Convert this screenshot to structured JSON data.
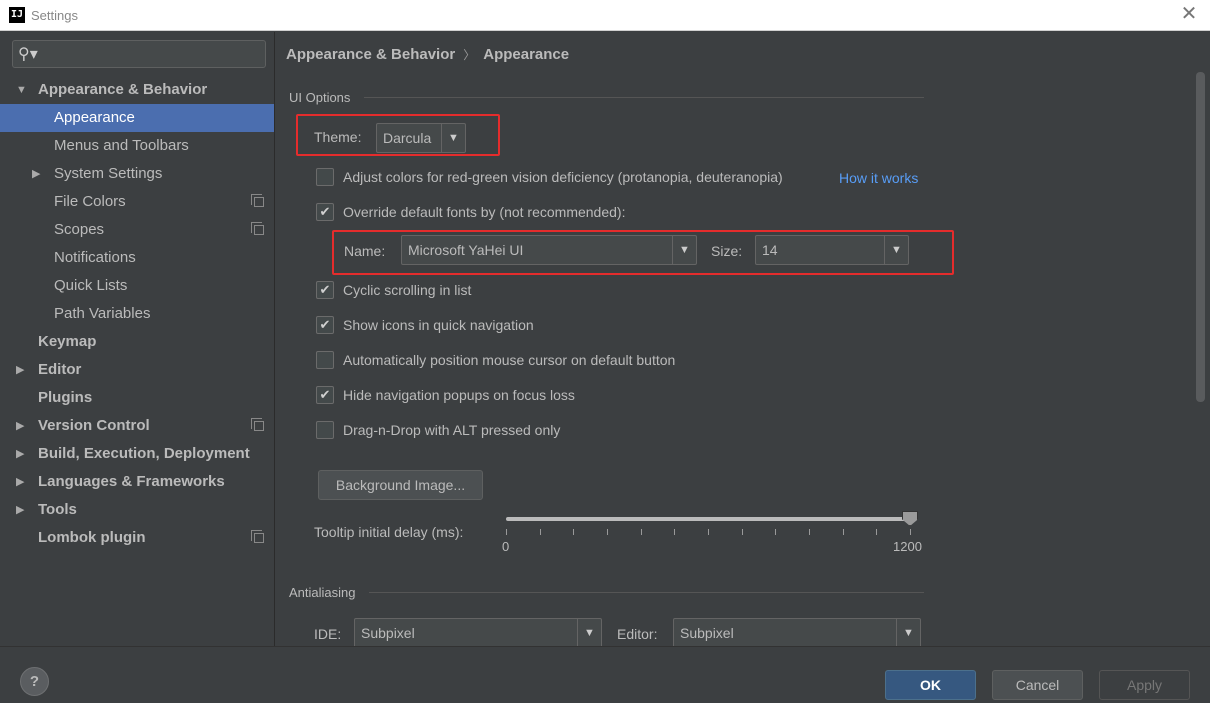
{
  "window": {
    "icon_text": "IJ",
    "title": "Settings",
    "close_glyph": "✕"
  },
  "sidebar": {
    "search": {
      "icon": "search-icon",
      "placeholder": "",
      "value": ""
    },
    "items": [
      {
        "label": "Appearance & Behavior",
        "level": 0,
        "bold": true,
        "expander": "▼",
        "copy": false
      },
      {
        "label": "Appearance",
        "level": 1,
        "bold": false,
        "expander": "",
        "copy": false,
        "selected": true
      },
      {
        "label": "Menus and Toolbars",
        "level": 1,
        "bold": false,
        "expander": "",
        "copy": false
      },
      {
        "label": "System Settings",
        "level": 1,
        "bold": false,
        "expander": "▶",
        "copy": false
      },
      {
        "label": "File Colors",
        "level": 1,
        "bold": false,
        "expander": "",
        "copy": true
      },
      {
        "label": "Scopes",
        "level": 1,
        "bold": false,
        "expander": "",
        "copy": true
      },
      {
        "label": "Notifications",
        "level": 1,
        "bold": false,
        "expander": "",
        "copy": false
      },
      {
        "label": "Quick Lists",
        "level": 1,
        "bold": false,
        "expander": "",
        "copy": false
      },
      {
        "label": "Path Variables",
        "level": 1,
        "bold": false,
        "expander": "",
        "copy": false
      },
      {
        "label": "Keymap",
        "level": 0,
        "bold": true,
        "expander": "",
        "copy": false
      },
      {
        "label": "Editor",
        "level": 0,
        "bold": true,
        "expander": "▶",
        "copy": false
      },
      {
        "label": "Plugins",
        "level": 0,
        "bold": true,
        "expander": "",
        "copy": false
      },
      {
        "label": "Version Control",
        "level": 0,
        "bold": true,
        "expander": "▶",
        "copy": true
      },
      {
        "label": "Build, Execution, Deployment",
        "level": 0,
        "bold": true,
        "expander": "▶",
        "copy": false
      },
      {
        "label": "Languages & Frameworks",
        "level": 0,
        "bold": true,
        "expander": "▶",
        "copy": false
      },
      {
        "label": "Tools",
        "level": 0,
        "bold": true,
        "expander": "▶",
        "copy": false
      },
      {
        "label": "Lombok plugin",
        "level": 0,
        "bold": true,
        "expander": "",
        "copy": true
      }
    ]
  },
  "breadcrumb": {
    "parent": "Appearance & Behavior",
    "separator": "〉",
    "current": "Appearance"
  },
  "ui_options": {
    "title": "UI Options",
    "theme": {
      "label": "Theme:",
      "value": "Darcula"
    },
    "adjust_colors": {
      "label": "Adjust colors for red-green vision deficiency (protanopia, deuteranopia)",
      "checked": false,
      "link": "How it works"
    },
    "override_fonts": {
      "label": "Override default fonts by (not recommended):",
      "checked": true
    },
    "font_name": {
      "label": "Name:",
      "value": "Microsoft YaHei UI"
    },
    "font_size": {
      "label": "Size:",
      "value": "14"
    },
    "cyclic_scrolling": {
      "label": "Cyclic scrolling in list",
      "checked": true
    },
    "show_icons": {
      "label": "Show icons in quick navigation",
      "checked": true
    },
    "auto_mouse": {
      "label": "Automatically position mouse cursor on default button",
      "checked": false
    },
    "hide_popups": {
      "label": "Hide navigation popups on focus loss",
      "checked": true
    },
    "drag_drop": {
      "label": "Drag-n-Drop with ALT pressed only",
      "checked": false
    },
    "background_image_button": "Background Image...",
    "tooltip": {
      "label": "Tooltip initial delay (ms):",
      "min": "0",
      "max": "1200",
      "value": 1200
    }
  },
  "antialiasing": {
    "title": "Antialiasing",
    "ide": {
      "label": "IDE:",
      "value": "Subpixel"
    },
    "editor": {
      "label": "Editor:",
      "value": "Subpixel"
    }
  },
  "footer": {
    "help": "?",
    "ok": "OK",
    "cancel": "Cancel",
    "apply": "Apply"
  },
  "glyphs": {
    "dropdown": "▼",
    "check": "✔"
  },
  "colors": {
    "accent_selection": "#4b6eaf",
    "highlight_box": "#e52c2c",
    "link": "#589df6",
    "ok_button": "#365880"
  }
}
